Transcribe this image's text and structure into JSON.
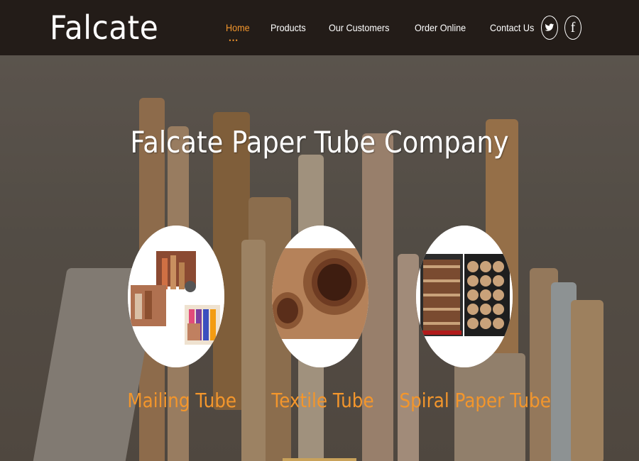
{
  "brand": {
    "logo_text": "Falcate"
  },
  "nav": {
    "items": [
      {
        "label": "Home",
        "active": true
      },
      {
        "label": "Products",
        "active": false
      },
      {
        "label": "Our Customers",
        "active": false
      },
      {
        "label": "Order Online",
        "active": false
      },
      {
        "label": "Contact Us",
        "active": false
      }
    ],
    "active_indicator": "•••"
  },
  "social": {
    "twitter_icon": "twitter-icon",
    "facebook_icon": "facebook-icon",
    "facebook_glyph": "f"
  },
  "hero": {
    "title": "Falcate Paper Tube Company",
    "products": [
      {
        "label": "Mailing Tube",
        "image": "mailing-tube-image"
      },
      {
        "label": "Textile Tube",
        "image": "textile-tube-image"
      },
      {
        "label": "Spiral Paper Tube",
        "image": "spiral-paper-tube-image"
      }
    ]
  },
  "colors": {
    "header_bg": "#231c18",
    "accent": "#f3962c",
    "text": "#ffffff"
  }
}
